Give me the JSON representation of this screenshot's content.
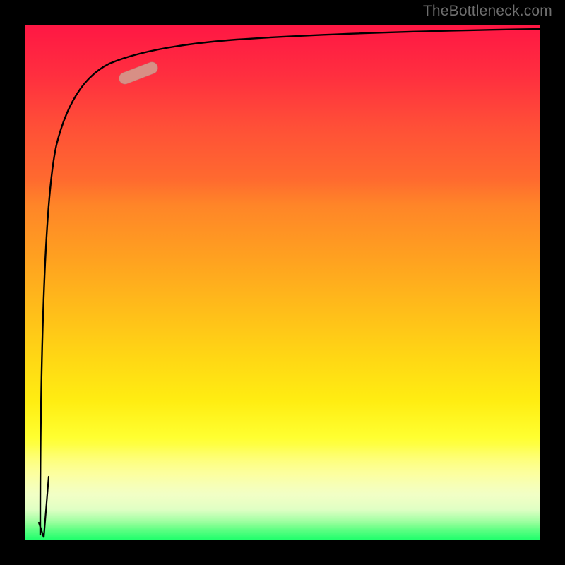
{
  "watermark": "TheBottleneck.com",
  "colors": {
    "plot_border": "#000000",
    "curve": "#000000",
    "pill": "#d88f85",
    "gradient_stops": [
      "#ff1744",
      "#ff5037",
      "#ff8528",
      "#ffbc1a",
      "#ffed12",
      "#ffff30",
      "#f4ffc0",
      "#1dff6b"
    ]
  },
  "chart_data": {
    "type": "line",
    "title": "",
    "xlabel": "",
    "ylabel": "",
    "xlim": [
      0,
      100
    ],
    "ylim": [
      0,
      100
    ],
    "series": [
      {
        "name": "curve",
        "x": [
          3,
          4,
          5,
          6,
          7,
          8,
          9,
          10,
          12,
          15,
          18,
          22,
          28,
          35,
          45,
          60,
          80,
          100
        ],
        "values": [
          1,
          30,
          55,
          70,
          78,
          83,
          86,
          88,
          90,
          91.5,
          92.5,
          93.5,
          94.3,
          95,
          95.6,
          96.2,
          96.8,
          97.3
        ]
      }
    ],
    "marker": {
      "type": "pill",
      "x_center": 21.5,
      "y_center": 91,
      "rotation_deg": -21,
      "color": "#d88f85"
    },
    "background": "vertical_gradient_red_to_green"
  }
}
